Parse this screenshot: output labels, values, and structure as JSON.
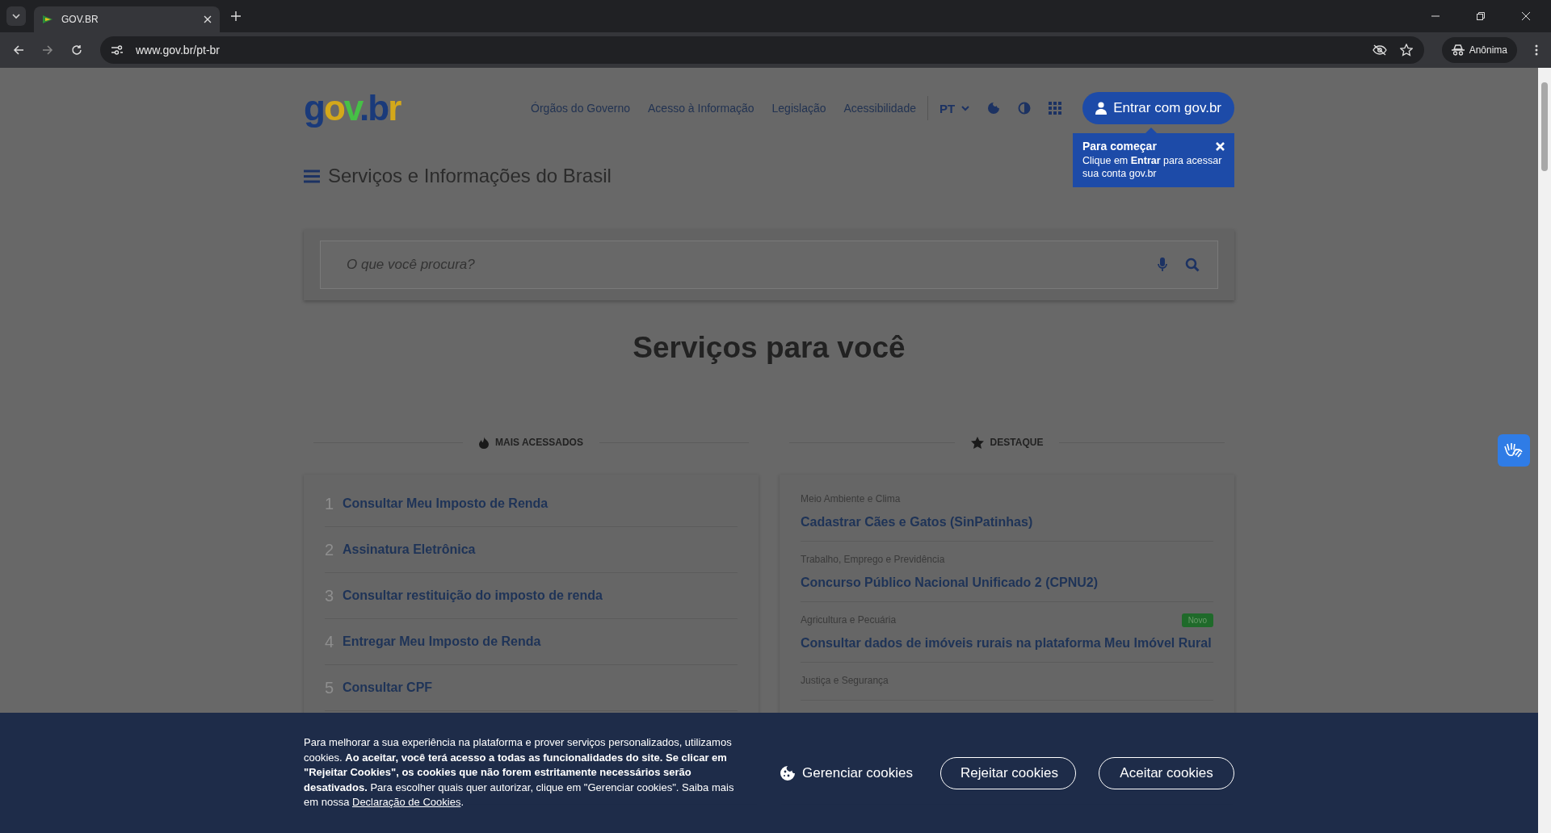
{
  "browser": {
    "tabs": [
      {
        "title": "GOV.BR",
        "selected": true
      }
    ],
    "url": "www.gov.br/pt-br",
    "profile": "Anônima"
  },
  "header": {
    "logo": "gov.br",
    "nav": [
      "Órgãos do Governo",
      "Acesso à Informação",
      "Legislação",
      "Acessibilidade"
    ],
    "language": "PT",
    "login": "Entrar com gov.br"
  },
  "tooltip": {
    "title": "Para começar",
    "text": "Clique em **Entrar** para acessar sua conta gov.br"
  },
  "menu_title": "Serviços e Informações do Brasil",
  "search": {
    "placeholder": "O que você procura?"
  },
  "section_title": "Serviços para você",
  "most_accessed": {
    "heading": "MAIS ACESSADOS",
    "items": [
      {
        "number": "1",
        "title": "Consultar Meu Imposto de Renda"
      },
      {
        "number": "2",
        "title": "Assinatura Eletrônica"
      },
      {
        "number": "3",
        "title": "Consultar restituição do imposto de renda"
      },
      {
        "number": "4",
        "title": "Entregar Meu Imposto de Renda"
      },
      {
        "number": "5",
        "title": "Consultar CPF"
      }
    ]
  },
  "highlights": {
    "heading": "DESTAQUE",
    "items": [
      {
        "category": "Meio Ambiente e Clima",
        "title": "Cadastrar Cães e Gatos (SinPatinhas)"
      },
      {
        "category": "Trabalho, Emprego e Previdência",
        "title": "Concurso Público Nacional Unificado 2 (CPNU2)"
      },
      {
        "category": "Agricultura e Pecuária",
        "title": "Consultar dados de imóveis rurais na plataforma Meu Imóvel Rural",
        "badge": "Novo"
      },
      {
        "category": "Justiça e Segurança"
      }
    ]
  },
  "cookie_banner": {
    "text": "Para melhorar a sua experiência na plataforma e prover serviços personalizados, utilizamos cookies. **Ao aceitar, você terá acesso a todas as funcionalidades do site. Se clicar em \"Rejeitar Cookies\", os cookies que não forem estritamente necessários serão desativados.** Para escolher quais quer autorizar, clique em \"Gerenciar cookies\". Saiba mais em nossa",
    "link": "Declaração de Cookies",
    "text_end": ".",
    "manage": "Gerenciar cookies",
    "reject": "Rejeitar cookies",
    "accept": "Aceitar cookies"
  }
}
